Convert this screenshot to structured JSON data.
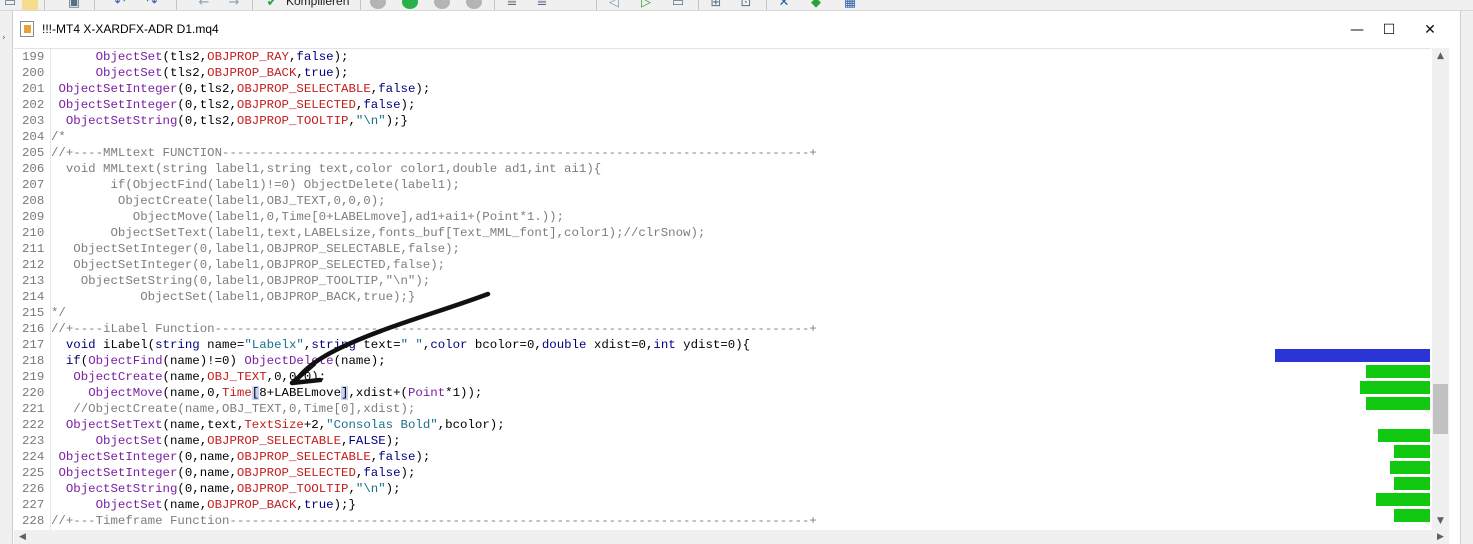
{
  "toolbar": {
    "compile_label": "Kompilieren",
    "icons": [
      "new-icon",
      "open-icon",
      "save-icon",
      "undo-icon",
      "redo-icon",
      "back-icon",
      "forward-icon",
      "compile-icon",
      "stop-icon",
      "start-icon",
      "pause-icon",
      "step-icon",
      "indent-icon",
      "comment-icon",
      "bookmark-icon",
      "navigate-icon",
      "zoom-icon",
      "tools-icon",
      "check-icon",
      "chart-icon"
    ]
  },
  "window": {
    "title": "!!!-MT4 X-XARDFX-ADR D1.mq4",
    "minimize": "—",
    "maximize": "☐",
    "close": "✕"
  },
  "editor": {
    "lines": [
      {
        "n": "199",
        "t": [
          [
            "p",
            "      "
          ],
          [
            "fn",
            "ObjectSet"
          ],
          [
            "p",
            "(tls2,"
          ],
          [
            "c",
            "OBJPROP_RAY"
          ],
          [
            "p",
            ","
          ],
          [
            "k",
            "false"
          ],
          [
            "p",
            ");"
          ]
        ]
      },
      {
        "n": "200",
        "t": [
          [
            "p",
            "      "
          ],
          [
            "fn",
            "ObjectSet"
          ],
          [
            "p",
            "(tls2,"
          ],
          [
            "c",
            "OBJPROP_BACK"
          ],
          [
            "p",
            ","
          ],
          [
            "k",
            "true"
          ],
          [
            "p",
            ");"
          ]
        ]
      },
      {
        "n": "201",
        "t": [
          [
            "p",
            " "
          ],
          [
            "fn",
            "ObjectSetInteger"
          ],
          [
            "p",
            "(0,tls2,"
          ],
          [
            "c",
            "OBJPROP_SELECTABLE"
          ],
          [
            "p",
            ","
          ],
          [
            "k",
            "false"
          ],
          [
            "p",
            ");"
          ]
        ]
      },
      {
        "n": "202",
        "t": [
          [
            "p",
            " "
          ],
          [
            "fn",
            "ObjectSetInteger"
          ],
          [
            "p",
            "(0,tls2,"
          ],
          [
            "c",
            "OBJPROP_SELECTED"
          ],
          [
            "p",
            ","
          ],
          [
            "k",
            "false"
          ],
          [
            "p",
            ");"
          ]
        ]
      },
      {
        "n": "203",
        "t": [
          [
            "p",
            "  "
          ],
          [
            "fn",
            "ObjectSetString"
          ],
          [
            "p",
            "(0,tls2,"
          ],
          [
            "c",
            "OBJPROP_TOOLTIP"
          ],
          [
            "p",
            ","
          ],
          [
            "s",
            "\"\\n\""
          ],
          [
            "p",
            ");}"
          ]
        ]
      },
      {
        "n": "204",
        "t": [
          [
            "cm",
            "/*"
          ]
        ]
      },
      {
        "n": "205",
        "t": [
          [
            "cm",
            "//+----MMLtext FUNCTION-------------------------------------------------------------------------------+"
          ]
        ]
      },
      {
        "n": "206",
        "t": [
          [
            "cm",
            "  void MMLtext(string label1,string text,color color1,double ad1,int ai1){"
          ]
        ]
      },
      {
        "n": "207",
        "t": [
          [
            "cm",
            "        if(ObjectFind(label1)!=0) ObjectDelete(label1);"
          ]
        ]
      },
      {
        "n": "208",
        "t": [
          [
            "cm",
            "         ObjectCreate(label1,OBJ_TEXT,0,0,0);"
          ]
        ]
      },
      {
        "n": "209",
        "t": [
          [
            "cm",
            "           ObjectMove(label1,0,Time[0+LABELmove],ad1+ai1+(Point*1.));"
          ]
        ]
      },
      {
        "n": "210",
        "t": [
          [
            "cm",
            "        ObjectSetText(label1,text,LABELsize,fonts_buf[Text_MML_font],color1);//clrSnow);"
          ]
        ]
      },
      {
        "n": "211",
        "t": [
          [
            "cm",
            "   ObjectSetInteger(0,label1,OBJPROP_SELECTABLE,false);"
          ]
        ]
      },
      {
        "n": "212",
        "t": [
          [
            "cm",
            "   ObjectSetInteger(0,label1,OBJPROP_SELECTED,false);"
          ]
        ]
      },
      {
        "n": "213",
        "t": [
          [
            "cm",
            "    ObjectSetString(0,label1,OBJPROP_TOOLTIP,\"\\n\");"
          ]
        ]
      },
      {
        "n": "214",
        "t": [
          [
            "cm",
            "            ObjectSet(label1,OBJPROP_BACK,true);}"
          ]
        ]
      },
      {
        "n": "215",
        "t": [
          [
            "cm",
            "*/"
          ]
        ]
      },
      {
        "n": "216",
        "t": [
          [
            "cm",
            "//+----iLabel Function--------------------------------------------------------------------------------+"
          ]
        ]
      },
      {
        "n": "217",
        "t": [
          [
            "p",
            "  "
          ],
          [
            "k",
            "void"
          ],
          [
            "p",
            " iLabel("
          ],
          [
            "k",
            "string"
          ],
          [
            "p",
            " name="
          ],
          [
            "s",
            "\"Labelx\""
          ],
          [
            "p",
            ","
          ],
          [
            "k",
            "string"
          ],
          [
            "p",
            " text="
          ],
          [
            "s",
            "\" \""
          ],
          [
            "p",
            ","
          ],
          [
            "k",
            "color"
          ],
          [
            "p",
            " bcolor=0,"
          ],
          [
            "k",
            "double"
          ],
          [
            "p",
            " xdist=0,"
          ],
          [
            "k",
            "int"
          ],
          [
            "p",
            " ydist=0){"
          ]
        ]
      },
      {
        "n": "218",
        "t": [
          [
            "p",
            "  "
          ],
          [
            "k",
            "if"
          ],
          [
            "p",
            "("
          ],
          [
            "fn",
            "ObjectFind"
          ],
          [
            "p",
            "(name)!=0) "
          ],
          [
            "fn",
            "ObjectDelete"
          ],
          [
            "p",
            "(name);"
          ]
        ]
      },
      {
        "n": "219",
        "t": [
          [
            "p",
            "   "
          ],
          [
            "fn",
            "ObjectCreate"
          ],
          [
            "p",
            "(name,"
          ],
          [
            "c",
            "OBJ_TEXT"
          ],
          [
            "p",
            ",0,0,0);"
          ]
        ]
      },
      {
        "n": "220",
        "t": [
          [
            "p",
            "     "
          ],
          [
            "fn",
            "ObjectMove"
          ],
          [
            "p",
            "(name,0,"
          ],
          [
            "c",
            "Time"
          ],
          [
            "hl",
            "["
          ],
          [
            "p",
            "8+LABELmove"
          ],
          [
            "hl",
            "]"
          ],
          [
            "p",
            ",xdist+("
          ],
          [
            "fn",
            "Point"
          ],
          [
            "p",
            "*1));"
          ]
        ]
      },
      {
        "n": "221",
        "t": [
          [
            "cm",
            "   //ObjectCreate(name,OBJ_TEXT,0,Time[0],xdist);"
          ]
        ]
      },
      {
        "n": "222",
        "t": [
          [
            "p",
            "  "
          ],
          [
            "fn",
            "ObjectSetText"
          ],
          [
            "p",
            "(name,text,"
          ],
          [
            "c",
            "TextSize"
          ],
          [
            "p",
            "+2,"
          ],
          [
            "s",
            "\"Consolas Bold\""
          ],
          [
            "p",
            ",bcolor);"
          ]
        ]
      },
      {
        "n": "223",
        "t": [
          [
            "p",
            "      "
          ],
          [
            "fn",
            "ObjectSet"
          ],
          [
            "p",
            "(name,"
          ],
          [
            "c",
            "OBJPROP_SELECTABLE"
          ],
          [
            "p",
            ","
          ],
          [
            "k",
            "FALSE"
          ],
          [
            "p",
            ");"
          ]
        ]
      },
      {
        "n": "224",
        "t": [
          [
            "p",
            " "
          ],
          [
            "fn",
            "ObjectSetInteger"
          ],
          [
            "p",
            "(0,name,"
          ],
          [
            "c",
            "OBJPROP_SELECTABLE"
          ],
          [
            "p",
            ","
          ],
          [
            "k",
            "false"
          ],
          [
            "p",
            ");"
          ]
        ]
      },
      {
        "n": "225",
        "t": [
          [
            "p",
            " "
          ],
          [
            "fn",
            "ObjectSetInteger"
          ],
          [
            "p",
            "(0,name,"
          ],
          [
            "c",
            "OBJPROP_SELECTED"
          ],
          [
            "p",
            ","
          ],
          [
            "k",
            "false"
          ],
          [
            "p",
            ");"
          ]
        ]
      },
      {
        "n": "226",
        "t": [
          [
            "p",
            "  "
          ],
          [
            "fn",
            "ObjectSetString"
          ],
          [
            "p",
            "(0,name,"
          ],
          [
            "c",
            "OBJPROP_TOOLTIP"
          ],
          [
            "p",
            ","
          ],
          [
            "s",
            "\"\\n\""
          ],
          [
            "p",
            ");"
          ]
        ]
      },
      {
        "n": "227",
        "t": [
          [
            "p",
            "      "
          ],
          [
            "fn",
            "ObjectSet"
          ],
          [
            "p",
            "(name,"
          ],
          [
            "c",
            "OBJPROP_BACK"
          ],
          [
            "p",
            ","
          ],
          [
            "k",
            "true"
          ],
          [
            "p",
            ");}"
          ]
        ]
      },
      {
        "n": "228",
        "t": [
          [
            "cm",
            "//+---Timeframe Function------------------------------------------------------------------------------+"
          ]
        ]
      }
    ]
  },
  "minimap": {
    "blue": "#2b35d6",
    "green": "#12c912"
  },
  "scrollbar": {
    "up": "▲",
    "down": "▼",
    "left": "◀",
    "right": "▶"
  }
}
